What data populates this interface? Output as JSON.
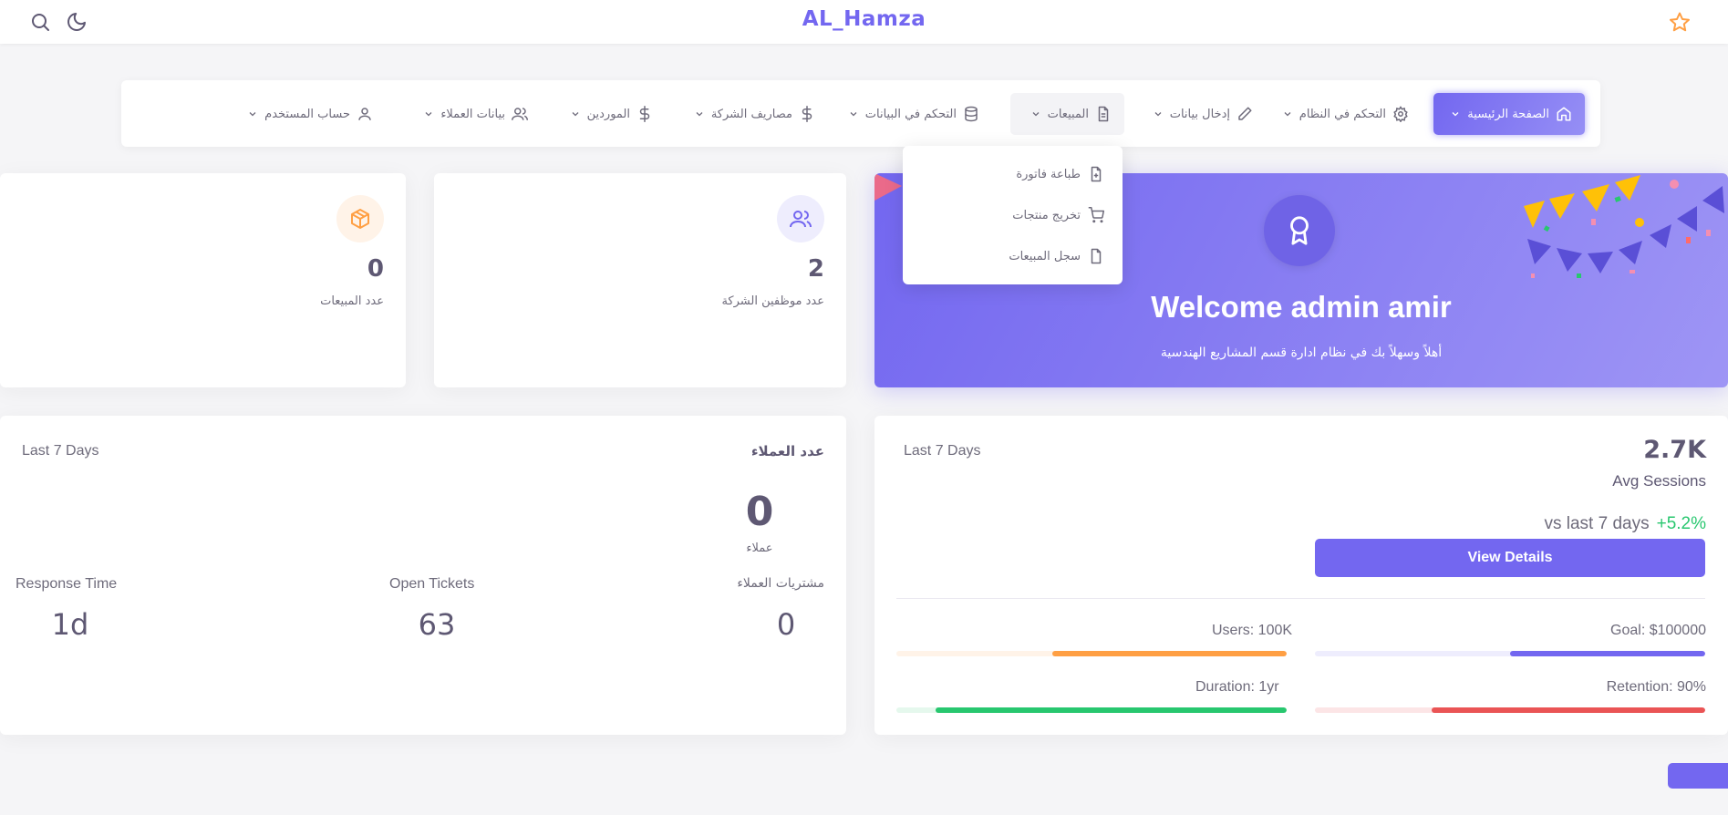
{
  "header": {
    "brand": "AL_Hamza",
    "icons": [
      "search-icon",
      "moon-icon",
      "star-icon"
    ]
  },
  "nav": {
    "items": [
      {
        "label": "الصفحة الرئيسية",
        "icon": "home-icon"
      },
      {
        "label": "التحكم في النظام",
        "icon": "settings-icon"
      },
      {
        "label": "إدخال بيانات",
        "icon": "pencil-icon"
      },
      {
        "label": "المبيعات",
        "icon": "file-text-icon"
      },
      {
        "label": "التحكم في البيانات",
        "icon": "database-icon"
      },
      {
        "label": "مصاريف الشركة",
        "icon": "dollar-icon"
      },
      {
        "label": "الموردين",
        "icon": "dollar-icon"
      },
      {
        "label": "بيانات العملاء",
        "icon": "users-icon"
      },
      {
        "label": "حساب المستخدم",
        "icon": "user-icon"
      }
    ],
    "active": "الصفحة الرئيسية",
    "open": "المبيعات"
  },
  "dropdown": {
    "items": [
      {
        "label": "طباعة فاتورة",
        "icon": "file-plus-icon"
      },
      {
        "label": "تخريج منتجات",
        "icon": "cart-icon"
      },
      {
        "label": "سجل المبيعات",
        "icon": "file-icon"
      }
    ]
  },
  "welcome": {
    "title": "Welcome admin amir",
    "subtitle": "أهلاً وسهلاً بك في نظام ادارة قسم المشاريع الهندسية"
  },
  "stats": {
    "employees": {
      "value": "2",
      "label": "عدد موظفين الشركة"
    },
    "sales": {
      "value": "0",
      "label": "عدد المبيعات"
    }
  },
  "sessions": {
    "value": "2.7K",
    "label": "Avg Sessions",
    "period": "Last 7 Days",
    "compare_text": "vs last 7 days",
    "compare_value": "+5.2%",
    "button": "View Details",
    "progress": [
      {
        "label": "Goal: $100000",
        "percent": 50,
        "color": "#7367f0",
        "track": "#eeedfd"
      },
      {
        "label": "Users: 100K",
        "percent": 60,
        "color": "#ff9f43",
        "track": "#fff3e8"
      },
      {
        "label": "Retention: 90%",
        "percent": 70,
        "color": "#ea5455",
        "track": "#fce5e6"
      },
      {
        "label": "Duration: 1yr",
        "percent": 90,
        "color": "#28c76f",
        "track": "#e5f8ed"
      }
    ]
  },
  "customers": {
    "title": "عدد العملاء",
    "period": "Last 7 Days",
    "count": "0",
    "count_label": "عملاء",
    "metrics": [
      {
        "label": "مشتريات العملاء",
        "value": "0"
      },
      {
        "label": "Open Tickets",
        "value": "63"
      },
      {
        "label": "Response Time",
        "value": "1d"
      }
    ]
  },
  "colors": {
    "primary": "#7367f0",
    "warning": "#ff9f43",
    "success": "#28c76f",
    "danger": "#ea5455"
  }
}
